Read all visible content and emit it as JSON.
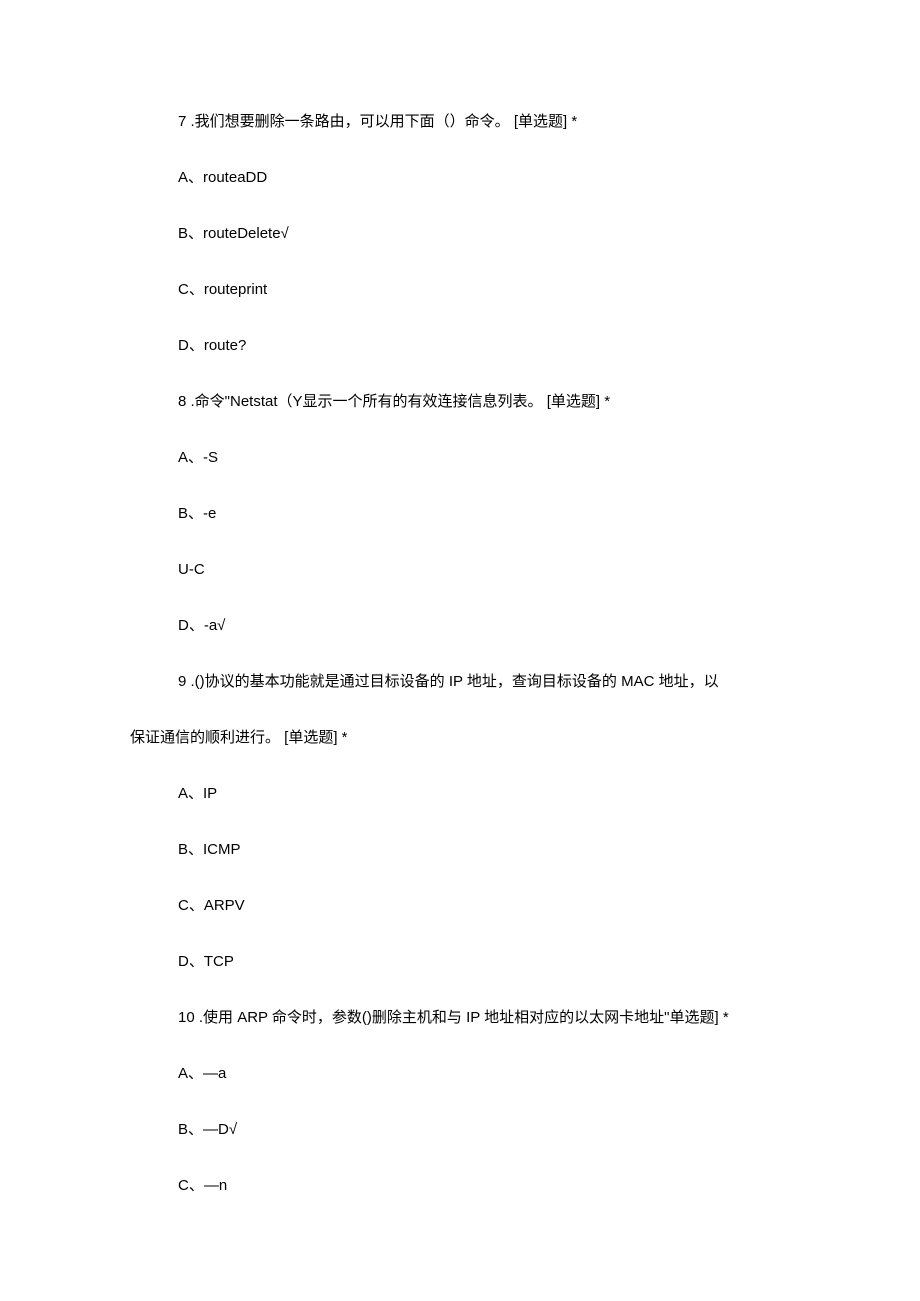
{
  "questions": [
    {
      "number": "7",
      "stem": ".我们想要删除一条路由，可以用下面（）命令。  [单选题]  *",
      "options": [
        "A、routeaDD",
        "B、routeDelete√",
        "C、routeprint",
        "D、route?"
      ]
    },
    {
      "number": "8",
      "stem": ".命令\"Netstat（Y显示一个所有的有效连接信息列表。  [单选题]  *",
      "options": [
        "A、-S",
        "B、-e",
        "U-C",
        "D、-a√"
      ]
    },
    {
      "number": "9",
      "stem": ".()协议的基本功能就是通过目标设备的 IP 地址，查询目标设备的 MAC 地址，以",
      "stem_wrap": "保证通信的顺利进行。  [单选题]  *",
      "options": [
        "A、IP",
        "B、ICMP",
        "C、ARPV",
        "D、TCP"
      ]
    },
    {
      "number": "10",
      "stem": ".使用 ARP 命令时，参数()删除主机和与 IP 地址相对应的以太网卡地址\"单选题]  *",
      "options": [
        "A、—a",
        "B、—D√",
        "C、—n"
      ]
    }
  ]
}
